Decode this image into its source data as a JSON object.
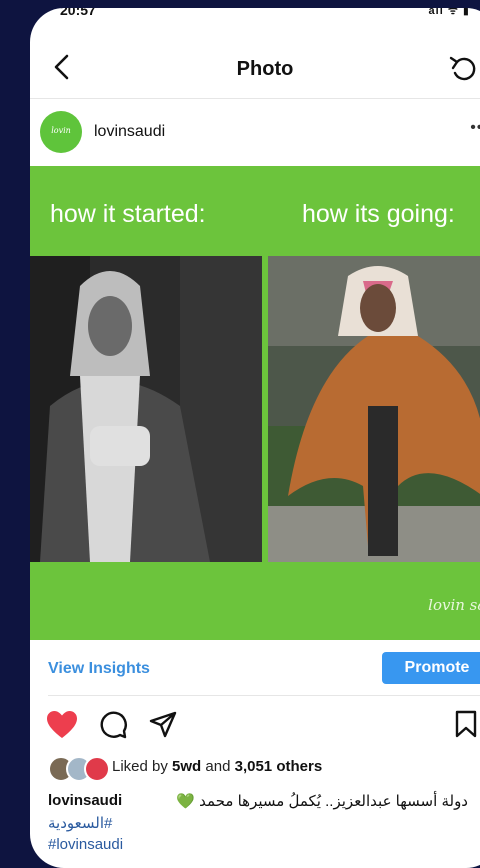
{
  "status_bar": {
    "time": "20:57",
    "icons": "all ᯤ ▮"
  },
  "nav": {
    "title": "Photo"
  },
  "profile": {
    "username": "lovinsaudi",
    "avatar_text": "lovin saudi",
    "more": "•••"
  },
  "post": {
    "caption_left": "how it started:",
    "caption_right": "how its going:",
    "watermark": "lovin sau"
  },
  "insights": {
    "view_label": "View Insights",
    "promote_label": "Promote"
  },
  "likes": {
    "prefix": "Liked by ",
    "user": "5wd",
    "middle": " and ",
    "count": "3,051 others"
  },
  "caption": {
    "username": "lovinsaudi",
    "text": "دولة أسسها عبدالعزيز.. يُكملُ مسيرها محمد 💚",
    "hashtag1": "#السعودية",
    "hashtag2": "#lovinsaudi"
  },
  "colors": {
    "accent_green": "#6cc43c",
    "link_blue": "#3b8fde",
    "button_blue": "#3897f0",
    "like_red": "#ed3e4e"
  }
}
